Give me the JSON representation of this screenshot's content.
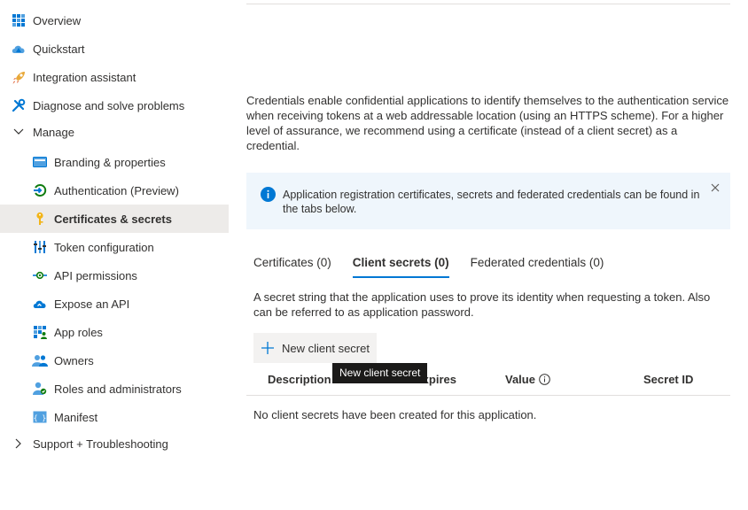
{
  "sidebar": {
    "items": [
      {
        "label": "Overview",
        "icon": "overview-grid-icon"
      },
      {
        "label": "Quickstart",
        "icon": "quickstart-cloud-icon"
      },
      {
        "label": "Integration assistant",
        "icon": "rocket-icon"
      },
      {
        "label": "Diagnose and solve problems",
        "icon": "wrench-icon"
      },
      {
        "label": "Manage",
        "icon": "chevron-down-icon",
        "expanded": true
      },
      {
        "label": "Branding & properties",
        "icon": "branding-card-icon"
      },
      {
        "label": "Authentication (Preview)",
        "icon": "authentication-arrow-icon"
      },
      {
        "label": "Certificates & secrets",
        "icon": "key-icon",
        "selected": true
      },
      {
        "label": "Token configuration",
        "icon": "token-bars-icon"
      },
      {
        "label": "API permissions",
        "icon": "api-permissions-icon"
      },
      {
        "label": "Expose an API",
        "icon": "expose-api-cloud-icon"
      },
      {
        "label": "App roles",
        "icon": "app-roles-grid-icon"
      },
      {
        "label": "Owners",
        "icon": "owners-people-icon"
      },
      {
        "label": "Roles and administrators",
        "icon": "roles-admin-person-icon"
      },
      {
        "label": "Manifest",
        "icon": "manifest-brackets-icon"
      },
      {
        "label": "Support + Troubleshooting",
        "icon": "chevron-right-icon",
        "expanded": false
      }
    ]
  },
  "main": {
    "intro": "Credentials enable confidential applications to identify themselves to the authentication service when receiving tokens at a web addressable location (using an HTTPS scheme). For a higher level of assurance, we recommend using a certificate (instead of a client secret) as a credential.",
    "info_banner": "Application registration certificates, secrets and federated credentials can be found in the tabs below.",
    "tabs": [
      {
        "label": "Certificates (0)",
        "active": false
      },
      {
        "label": "Client secrets (0)",
        "active": true
      },
      {
        "label": "Federated credentials (0)",
        "active": false
      }
    ],
    "secret_description": "A secret string that the application uses to prove its identity when requesting a token. Also can be referred to as application password.",
    "new_secret_button": "New client secret",
    "tooltip": "New client secret",
    "columns": {
      "description": "Description",
      "expires": "Expires",
      "value": "Value",
      "secret_id": "Secret ID"
    },
    "empty_message": "No client secrets have been created for this application."
  },
  "colors": {
    "accent": "#0078d4",
    "info_background": "#eff6fc",
    "selected_background": "#edebe9",
    "tooltip_background": "#1b1a19"
  }
}
